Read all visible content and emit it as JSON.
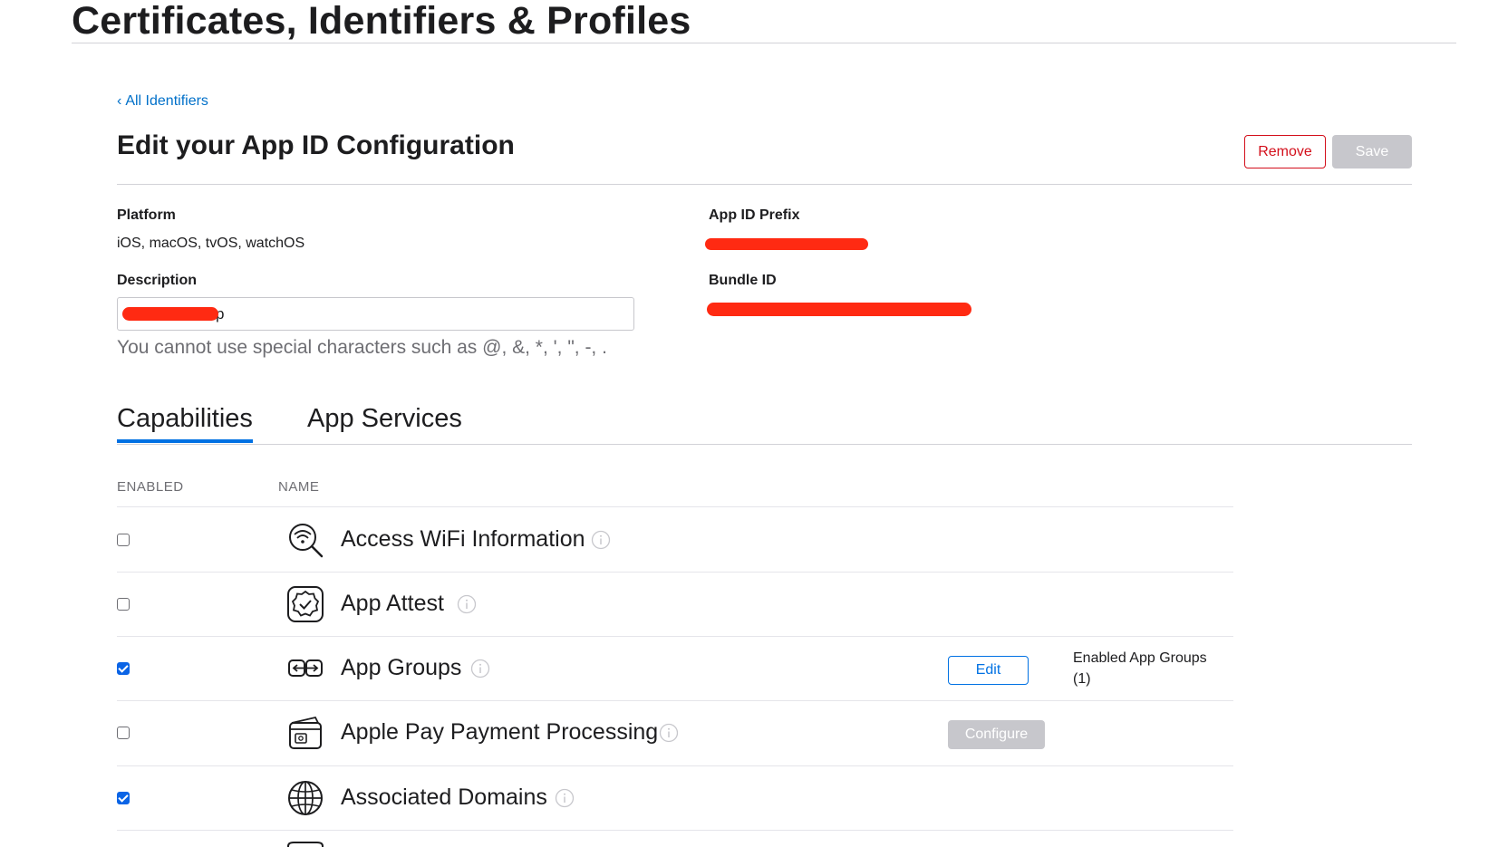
{
  "site": {
    "title": "Certificates, Identifiers & Profiles"
  },
  "nav": {
    "back_label": "All Identifiers"
  },
  "page": {
    "heading": "Edit your App ID Configuration"
  },
  "actions": {
    "remove_label": "Remove",
    "save_label": "Save"
  },
  "details": {
    "platform_label": "Platform",
    "platform_value": "iOS, macOS, tvOS, watchOS",
    "app_id_prefix_label": "App ID Prefix",
    "description_label": "Description",
    "description_value_visible_tail": "p",
    "description_hint": "You cannot use special characters such as @, &, *, ', \", -, .",
    "bundle_id_label": "Bundle ID"
  },
  "colors": {
    "redaction": "#ff2a12",
    "link": "#0070c9",
    "accent": "#0071e3",
    "danger": "#d30f1b"
  },
  "tabs": [
    {
      "label": "Capabilities",
      "active": true
    },
    {
      "label": "App Services",
      "active": false
    }
  ],
  "table": {
    "col_enabled": "ENABLED",
    "col_name": "NAME",
    "rows": [
      {
        "name": "Access WiFi Information",
        "enabled": false,
        "icon": "wifi-search-icon"
      },
      {
        "name": "App Attest",
        "enabled": false,
        "icon": "attest-badge-icon"
      },
      {
        "name": "App Groups",
        "enabled": true,
        "icon": "app-groups-icon",
        "edit_label": "Edit",
        "note_line1": "Enabled App Groups",
        "note_line2": "(1)"
      },
      {
        "name": "Apple Pay Payment Processing",
        "enabled": false,
        "icon": "wallet-card-icon",
        "configure_label": "Configure"
      },
      {
        "name": "Associated Domains",
        "enabled": true,
        "icon": "globe-icon"
      }
    ]
  }
}
